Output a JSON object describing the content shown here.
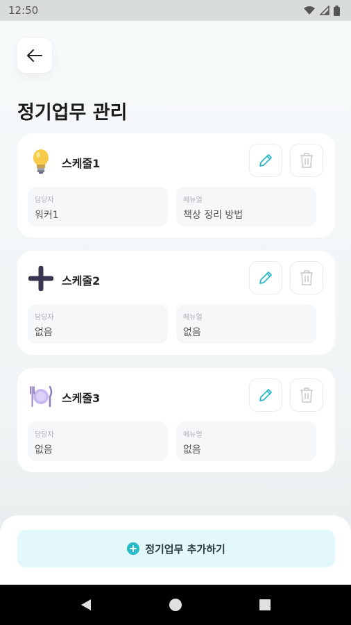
{
  "status_bar": {
    "time": "12:50"
  },
  "header": {
    "title": "정기업무 관리"
  },
  "schedules": [
    {
      "name": "스케줄1",
      "icon": "lightbulb-icon",
      "assignee_label": "담당자",
      "assignee": "워커1",
      "manual_label": "메뉴얼",
      "manual": "책상 정리 방법"
    },
    {
      "name": "스케줄2",
      "icon": "plus-icon",
      "assignee_label": "담당자",
      "assignee": "없음",
      "manual_label": "메뉴얼",
      "manual": "없음"
    },
    {
      "name": "스케줄3",
      "icon": "plate-utensils-icon",
      "assignee_label": "담당자",
      "assignee": "없음",
      "manual_label": "메뉴얼",
      "manual": "없음"
    }
  ],
  "footer": {
    "add_label": "정기업무 추가하기"
  },
  "colors": {
    "accent": "#29b9c9",
    "add_bg": "#e3f8fb",
    "card_bg": "#ffffff",
    "page_bg": "#f1f5f6"
  }
}
